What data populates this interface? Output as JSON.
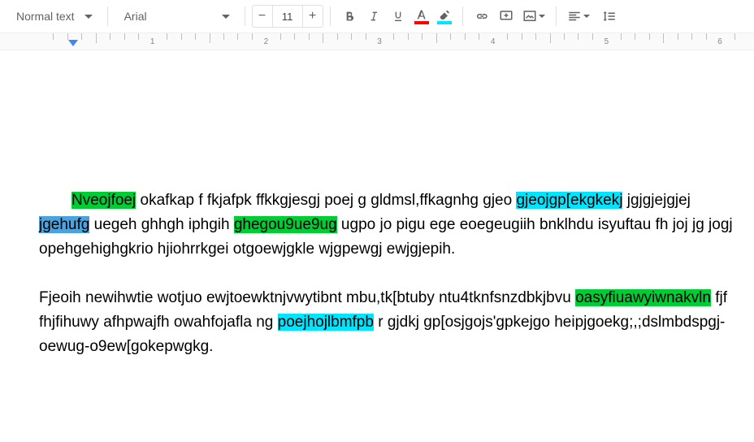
{
  "toolbar": {
    "style_label": "Normal text",
    "font_label": "Arial",
    "font_size": "11",
    "text_color": "#ff0000",
    "highlight_color": "#00e5ff"
  },
  "ruler": {
    "labels": [
      "1",
      "2",
      "3",
      "4",
      "5",
      "6"
    ],
    "indent_marker_col": 0.3
  },
  "colors": {
    "green": "#00cc33",
    "cyan": "#00e5ff",
    "skyblue": "#4aa3df"
  },
  "doc": {
    "p1": {
      "s0": {
        "t": "Nveojfoej",
        "hl": "green"
      },
      "s1": {
        "t": "  okafkap f fkjafpk ffkkgjesgj poej g gldmsl,ffkagnhg gjeo "
      },
      "s2": {
        "t": "gjeojgp[ekgkekj",
        "hl": "cyan"
      },
      "s3": {
        "t": " jgjgjejgjej "
      },
      "s4": {
        "t": "jgehufg",
        "hl": "skyblue"
      },
      "s5": {
        "t": " uegeh ghhgh iphgih "
      },
      "s6": {
        "t": "ghegou9ue9ug",
        "hl": "green"
      },
      "s7": {
        "t": " ugpo jo pigu ege  eoegeugiih bnklhdu isyuftau fh joj jg  jogj opehgehighgkrio hjiohrrkgei otgoewjgkle wjgpewgj ewjgjepih."
      }
    },
    "p2": {
      "s0": {
        "t": "Fjeoih newihwtie wotjuo ewjtoewktnjvwytibnt  mbu,tk[btuby ntu4tknfsnzdbkjbvu "
      },
      "s1": {
        "t": "oasyfiuawyiwnakvln",
        "hl": "green"
      },
      "s2": {
        "t": " fjf fhjfihuwy  afhpwajfh owahfojafla ng "
      },
      "s3": {
        "t": "poejhojlbmfpb",
        "hl": "cyan"
      },
      "s4": {
        "t": " r gjdkj gp[osjgojs'gpkejgo heipjgoekg;,;dslmbdspgj-oewug-o9ew[gokepwgkg."
      }
    }
  }
}
